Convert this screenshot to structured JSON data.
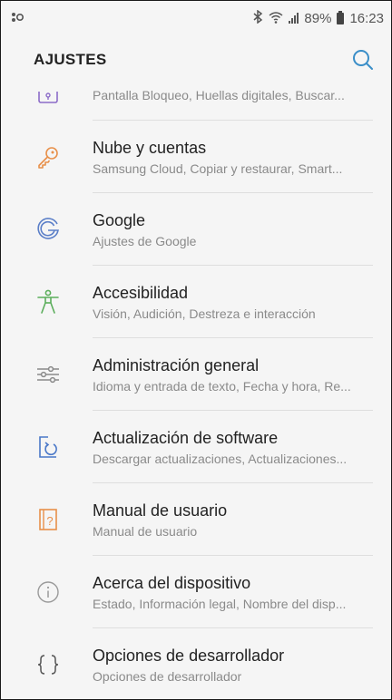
{
  "status_bar": {
    "battery_percent": "89%",
    "time": "16:23",
    "bluetooth_icon": "bluetooth-icon",
    "wifi_icon": "wifi-icon",
    "signal_icon": "signal-icon"
  },
  "header": {
    "title": "AJUSTES",
    "search_icon": "search-icon"
  },
  "partial_item": {
    "sublabel": "Pantalla Bloqueo, Huellas digitales, Buscar..."
  },
  "items": [
    {
      "label": "Nube y cuentas",
      "sublabel": "Samsung Cloud, Copiar y restaurar, Smart...",
      "icon": "key-icon",
      "color": "#e8904a"
    },
    {
      "label": "Google",
      "sublabel": "Ajustes de Google",
      "icon": "google-icon",
      "color": "#5b7fc8"
    },
    {
      "label": "Accesibilidad",
      "sublabel": "Visión, Audición, Destreza e interacción",
      "icon": "accessibility-icon",
      "color": "#5cae5c"
    },
    {
      "label": "Administración general",
      "sublabel": "Idioma y entrada de texto, Fecha y hora, Re...",
      "icon": "sliders-icon",
      "color": "#8a8a8a"
    },
    {
      "label": "Actualización de software",
      "sublabel": "Descargar actualizaciones, Actualizaciones...",
      "icon": "software-update-icon",
      "color": "#4a78c8"
    },
    {
      "label": "Manual de usuario",
      "sublabel": "Manual de usuario",
      "icon": "user-manual-icon",
      "color": "#e8904a"
    },
    {
      "label": "Acerca del dispositivo",
      "sublabel": "Estado, Información legal, Nombre del disp...",
      "icon": "info-icon",
      "color": "#8a8a8a"
    },
    {
      "label": "Opciones de desarrollador",
      "sublabel": "Opciones de desarrollador",
      "icon": "braces-icon",
      "color": "#555555"
    }
  ]
}
